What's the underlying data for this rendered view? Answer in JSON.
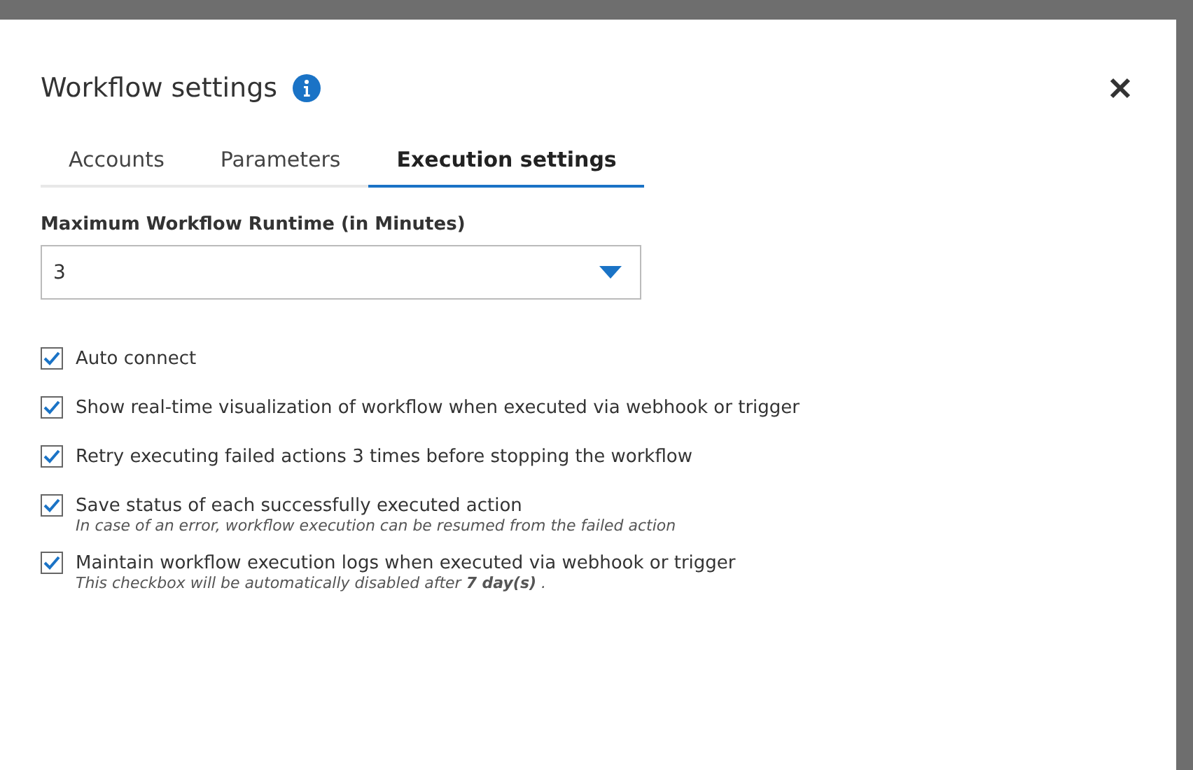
{
  "dialog": {
    "title": "Workflow settings"
  },
  "tabs": [
    {
      "label": "Accounts",
      "selected": false
    },
    {
      "label": "Parameters",
      "selected": false
    },
    {
      "label": "Execution settings",
      "selected": true
    }
  ],
  "runtime": {
    "label": "Maximum Workflow Runtime (in Minutes)",
    "value": "3"
  },
  "options": [
    {
      "label": "Auto connect",
      "checked": true
    },
    {
      "label": "Show real-time visualization of workflow when executed via webhook or trigger",
      "checked": true
    },
    {
      "label": "Retry executing failed actions 3 times before stopping the workflow",
      "checked": true
    },
    {
      "label": "Save status of each successfully executed action",
      "checked": true,
      "note": "In case of an error, workflow execution can be resumed from the failed action"
    },
    {
      "label": "Maintain workflow execution logs when executed via webhook or trigger",
      "checked": true,
      "note": "This checkbox will be automatically disabled after **7 day(s)** ."
    }
  ]
}
